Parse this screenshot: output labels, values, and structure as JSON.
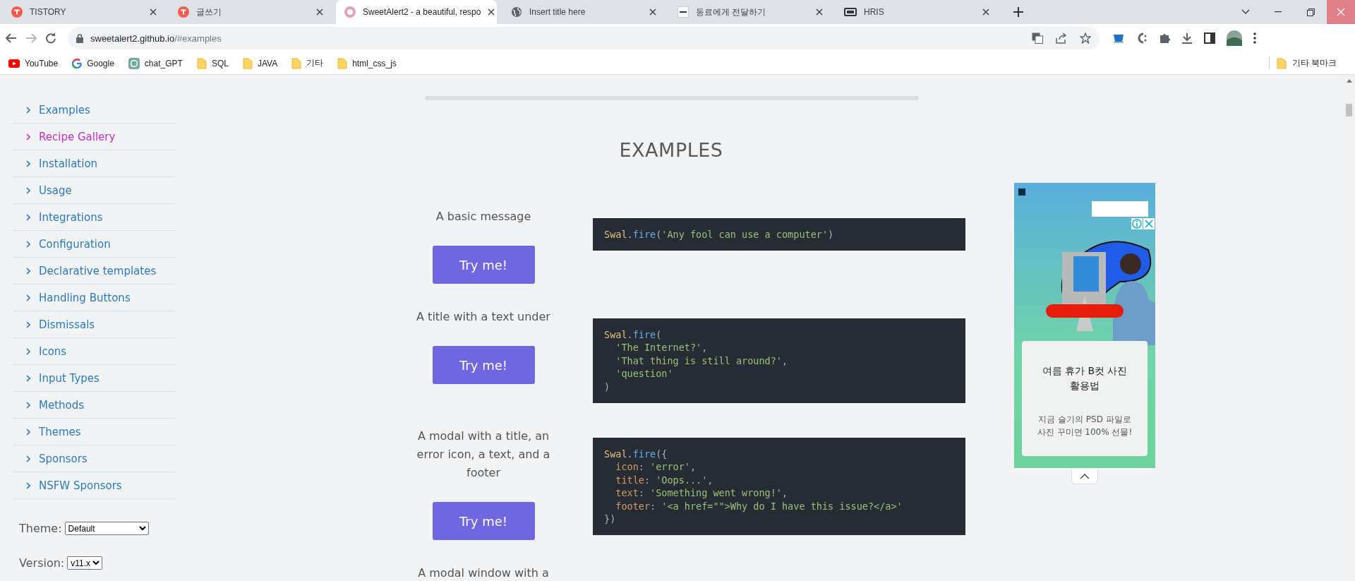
{
  "browser": {
    "tabs": [
      {
        "title": "TISTORY",
        "kind": "tistory",
        "selected": false
      },
      {
        "title": "글쓰기",
        "kind": "tistory",
        "selected": false
      },
      {
        "title": "SweetAlert2 - a beautiful, respo",
        "kind": "donut",
        "selected": true
      },
      {
        "title": "Insert title here",
        "kind": "globe",
        "selected": false
      },
      {
        "title": "동료에게 전달하기",
        "kind": "square",
        "selected": false
      },
      {
        "title": "HRIS",
        "kind": "monitor",
        "selected": false
      }
    ],
    "url": {
      "host": "sweetalert2.github.io",
      "path": "/#examples"
    },
    "bookmarks": [
      {
        "label": "YouTube",
        "kind": "youtube"
      },
      {
        "label": "Google",
        "kind": "google"
      },
      {
        "label": "chat_GPT",
        "kind": "chatgpt"
      },
      {
        "label": "SQL",
        "kind": "folder"
      },
      {
        "label": "JAVA",
        "kind": "folder"
      },
      {
        "label": "기타",
        "kind": "folder"
      },
      {
        "label": "html_css_js",
        "kind": "folder"
      }
    ],
    "other_bookmarks": "기타 북마크"
  },
  "sidebar": {
    "items": [
      {
        "label": "Examples",
        "selected": false
      },
      {
        "label": "Recipe Gallery",
        "selected": true
      },
      {
        "label": "Installation",
        "selected": false
      },
      {
        "label": "Usage",
        "selected": false
      },
      {
        "label": "Integrations",
        "selected": false
      },
      {
        "label": "Configuration",
        "selected": false
      },
      {
        "label": "Declarative templates",
        "selected": false
      },
      {
        "label": "Handling Buttons",
        "selected": false
      },
      {
        "label": "Dismissals",
        "selected": false
      },
      {
        "label": "Icons",
        "selected": false
      },
      {
        "label": "Input Types",
        "selected": false
      },
      {
        "label": "Methods",
        "selected": false
      },
      {
        "label": "Themes",
        "selected": false
      },
      {
        "label": "Sponsors",
        "selected": false
      },
      {
        "label": "NSFW Sponsors",
        "selected": false
      }
    ],
    "theme": {
      "label": "Theme:",
      "value": "Default"
    },
    "version": {
      "label": "Version:",
      "value": "v11.x"
    }
  },
  "main": {
    "heading": "EXAMPLES",
    "examples": [
      {
        "description": "A basic message",
        "button": "Try me!",
        "code": [
          "Swal.fire('Any fool can use a computer')"
        ]
      },
      {
        "description": "A title with a text under",
        "button": "Try me!",
        "code": [
          "Swal.fire(",
          "  'The Internet?',",
          "  'That thing is still around?',",
          "  'question'",
          ")"
        ]
      },
      {
        "description": "A modal with a title, an error icon, a text, and a footer",
        "button": "Try me!",
        "code": [
          "Swal.fire({",
          "  icon: 'error',",
          "  title: 'Oops...',",
          "  text: 'Something went wrong!',",
          "  footer: '<a href=\"\">Why do I have this issue?</a>'",
          "})"
        ]
      },
      {
        "description": "A modal window with a"
      }
    ]
  },
  "ad": {
    "card_title": "여름 휴가 B컷 사진 활용법",
    "card_text": "지금 슬기의 PSD 파일로 사진 꾸미면 100% 선물!"
  }
}
